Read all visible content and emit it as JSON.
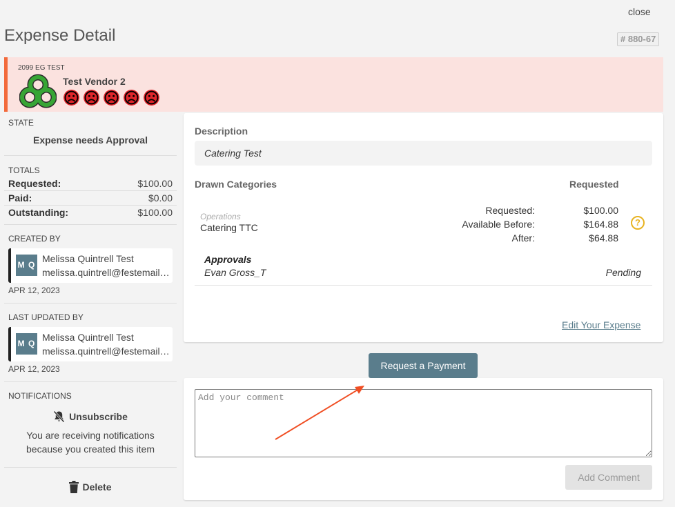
{
  "header": {
    "close_label": "close",
    "title": "Expense Detail",
    "reference": "# 880-67"
  },
  "vendor": {
    "tag": "2099 EG TEST",
    "name": "Test Vendor 2",
    "logo_icon": "green-interlinked-rings-logo",
    "rating_icon": "sad-face-icon",
    "rating_color": "#e0262b",
    "rating_count": 5,
    "banner_color": "#fbe2df",
    "accent_color": "#f26a3b"
  },
  "state": {
    "label": "STATE",
    "value": "Expense needs Approval"
  },
  "totals": {
    "label": "TOTALS",
    "rows": [
      {
        "key": "Requested:",
        "value": "$100.00"
      },
      {
        "key": "Paid:",
        "value": "$0.00"
      },
      {
        "key": "Outstanding:",
        "value": "$100.00"
      }
    ]
  },
  "created_by": {
    "label": "CREATED BY",
    "initials": "M Q",
    "name": "Melissa Quintrell Test",
    "email": "melissa.quintrell@festemail.com",
    "date": "APR 12, 2023"
  },
  "updated_by": {
    "label": "LAST UPDATED BY",
    "initials": "M Q",
    "name": "Melissa Quintrell Test",
    "email": "melissa.quintrell@festemail.com",
    "date": "APR 12, 2023"
  },
  "notifications": {
    "label": "NOTIFICATIONS",
    "unsubscribe_label": "Unsubscribe",
    "notice_line1": "You are receiving notifications",
    "notice_line2": "because you created this item"
  },
  "delete_label": "Delete",
  "detail": {
    "description_label": "Description",
    "description_value": "Catering Test",
    "drawn_label": "Drawn Categories",
    "requested_header": "Requested",
    "category_parent": "Operations",
    "category_name": "Catering TTC",
    "amount_keys": [
      "Requested:",
      "Available Before:",
      "After:"
    ],
    "amount_values": [
      "$100.00",
      "$164.88",
      "$64.88"
    ],
    "help_glyph": "?",
    "approvals_label": "Approvals",
    "approver": "Evan Gross_T",
    "approval_status": "Pending",
    "edit_link": "Edit Your Expense"
  },
  "actions": {
    "request_payment": "Request a Payment",
    "comment_placeholder": "Add your comment",
    "add_comment": "Add Comment"
  },
  "colors": {
    "primary_button": "#5a7d8c",
    "help_icon": "#e8b321",
    "annotation_arrow": "#f04e23"
  }
}
